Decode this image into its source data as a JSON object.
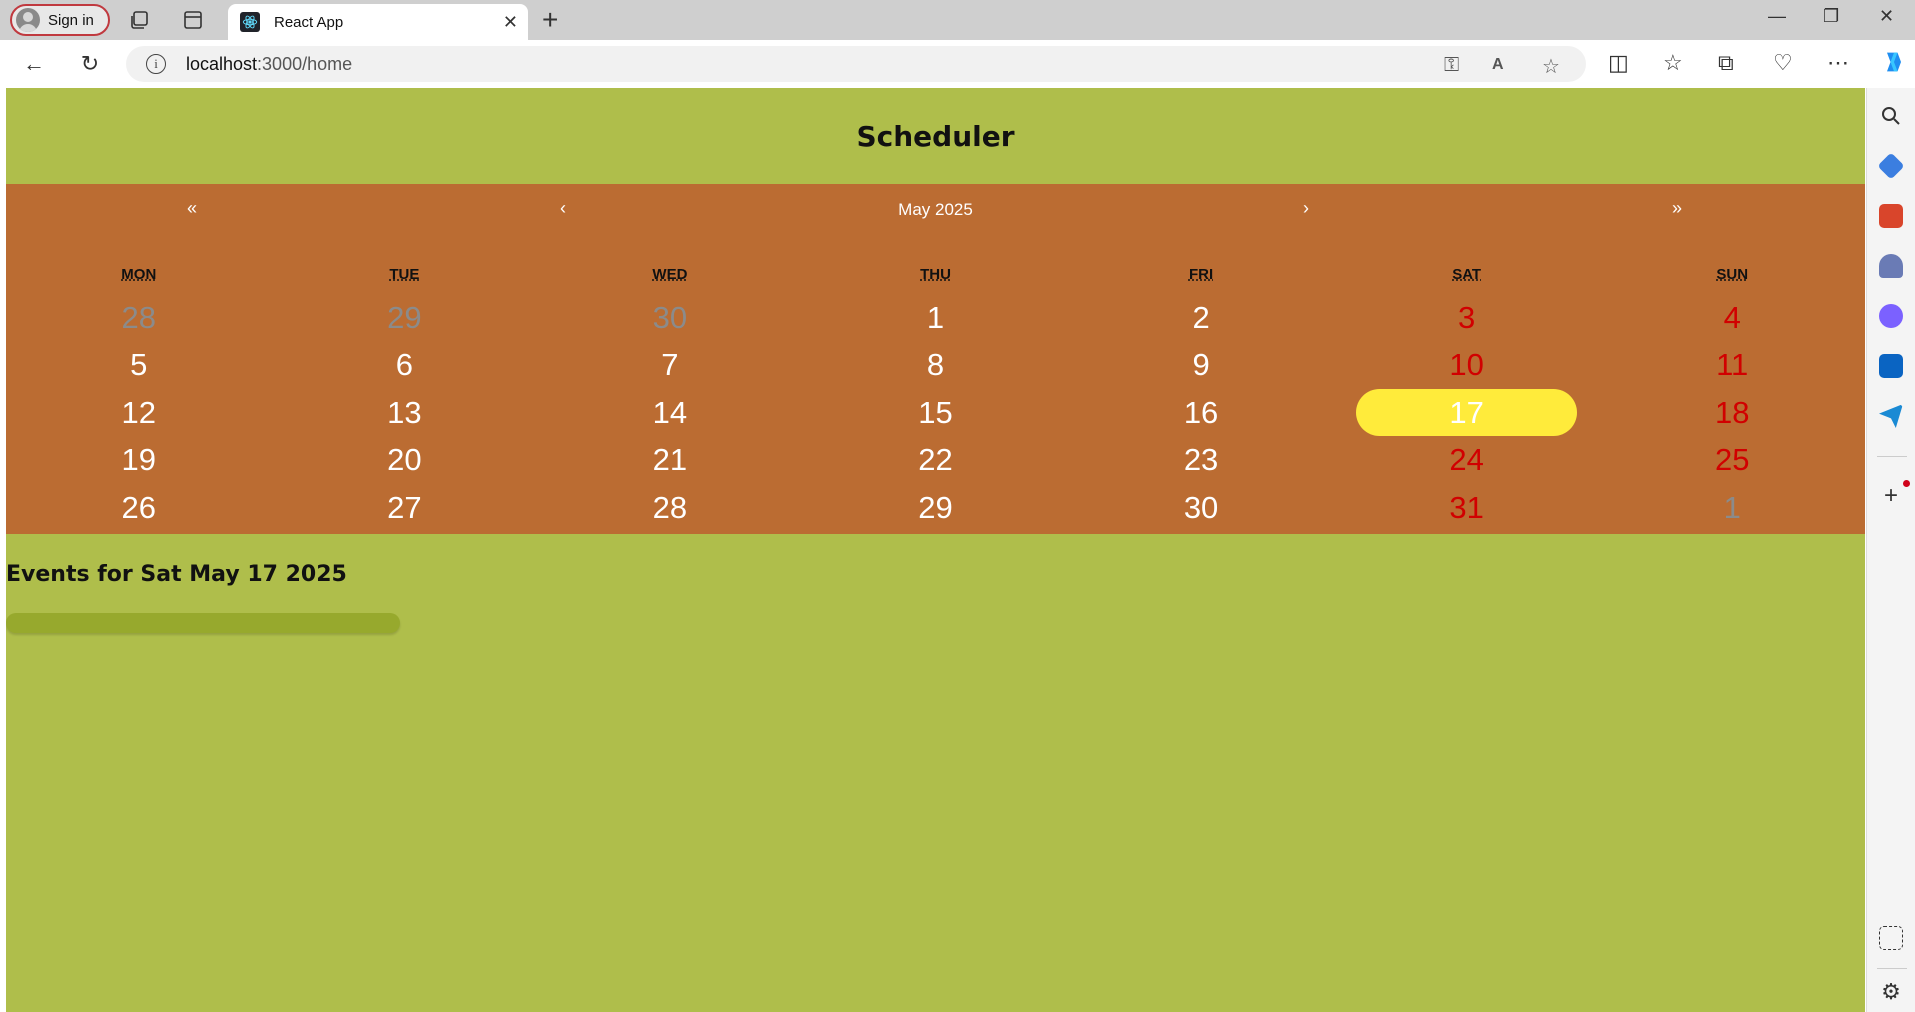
{
  "browser": {
    "signin_label": "Sign in",
    "tab_title": "React App",
    "url_host": "localhost",
    "url_path": ":3000/home"
  },
  "app": {
    "title": "Scheduler",
    "calendar": {
      "prev_year": "«",
      "prev_month": "‹",
      "month_label": "May 2025",
      "next_month": "›",
      "next_year": "»",
      "weekdays": [
        "MON",
        "TUE",
        "WED",
        "THU",
        "FRI",
        "SAT",
        "SUN"
      ],
      "weeks": [
        [
          "28",
          "29",
          "30",
          "1",
          "2",
          "3",
          "4"
        ],
        [
          "5",
          "6",
          "7",
          "8",
          "9",
          "10",
          "11"
        ],
        [
          "12",
          "13",
          "14",
          "15",
          "16",
          "17",
          "18"
        ],
        [
          "19",
          "20",
          "21",
          "22",
          "23",
          "24",
          "25"
        ],
        [
          "26",
          "27",
          "28",
          "29",
          "30",
          "31",
          "1"
        ]
      ],
      "selected_day": "17",
      "colors": {
        "page_background": "#afbe4b",
        "calendar_background": "#bb6c32",
        "weekend_text": "#d10000",
        "outside_month_text": "#8b8b8b",
        "selected_background": "#ffeb3b"
      }
    },
    "events_heading": "Events for Sat May 17 2025"
  }
}
